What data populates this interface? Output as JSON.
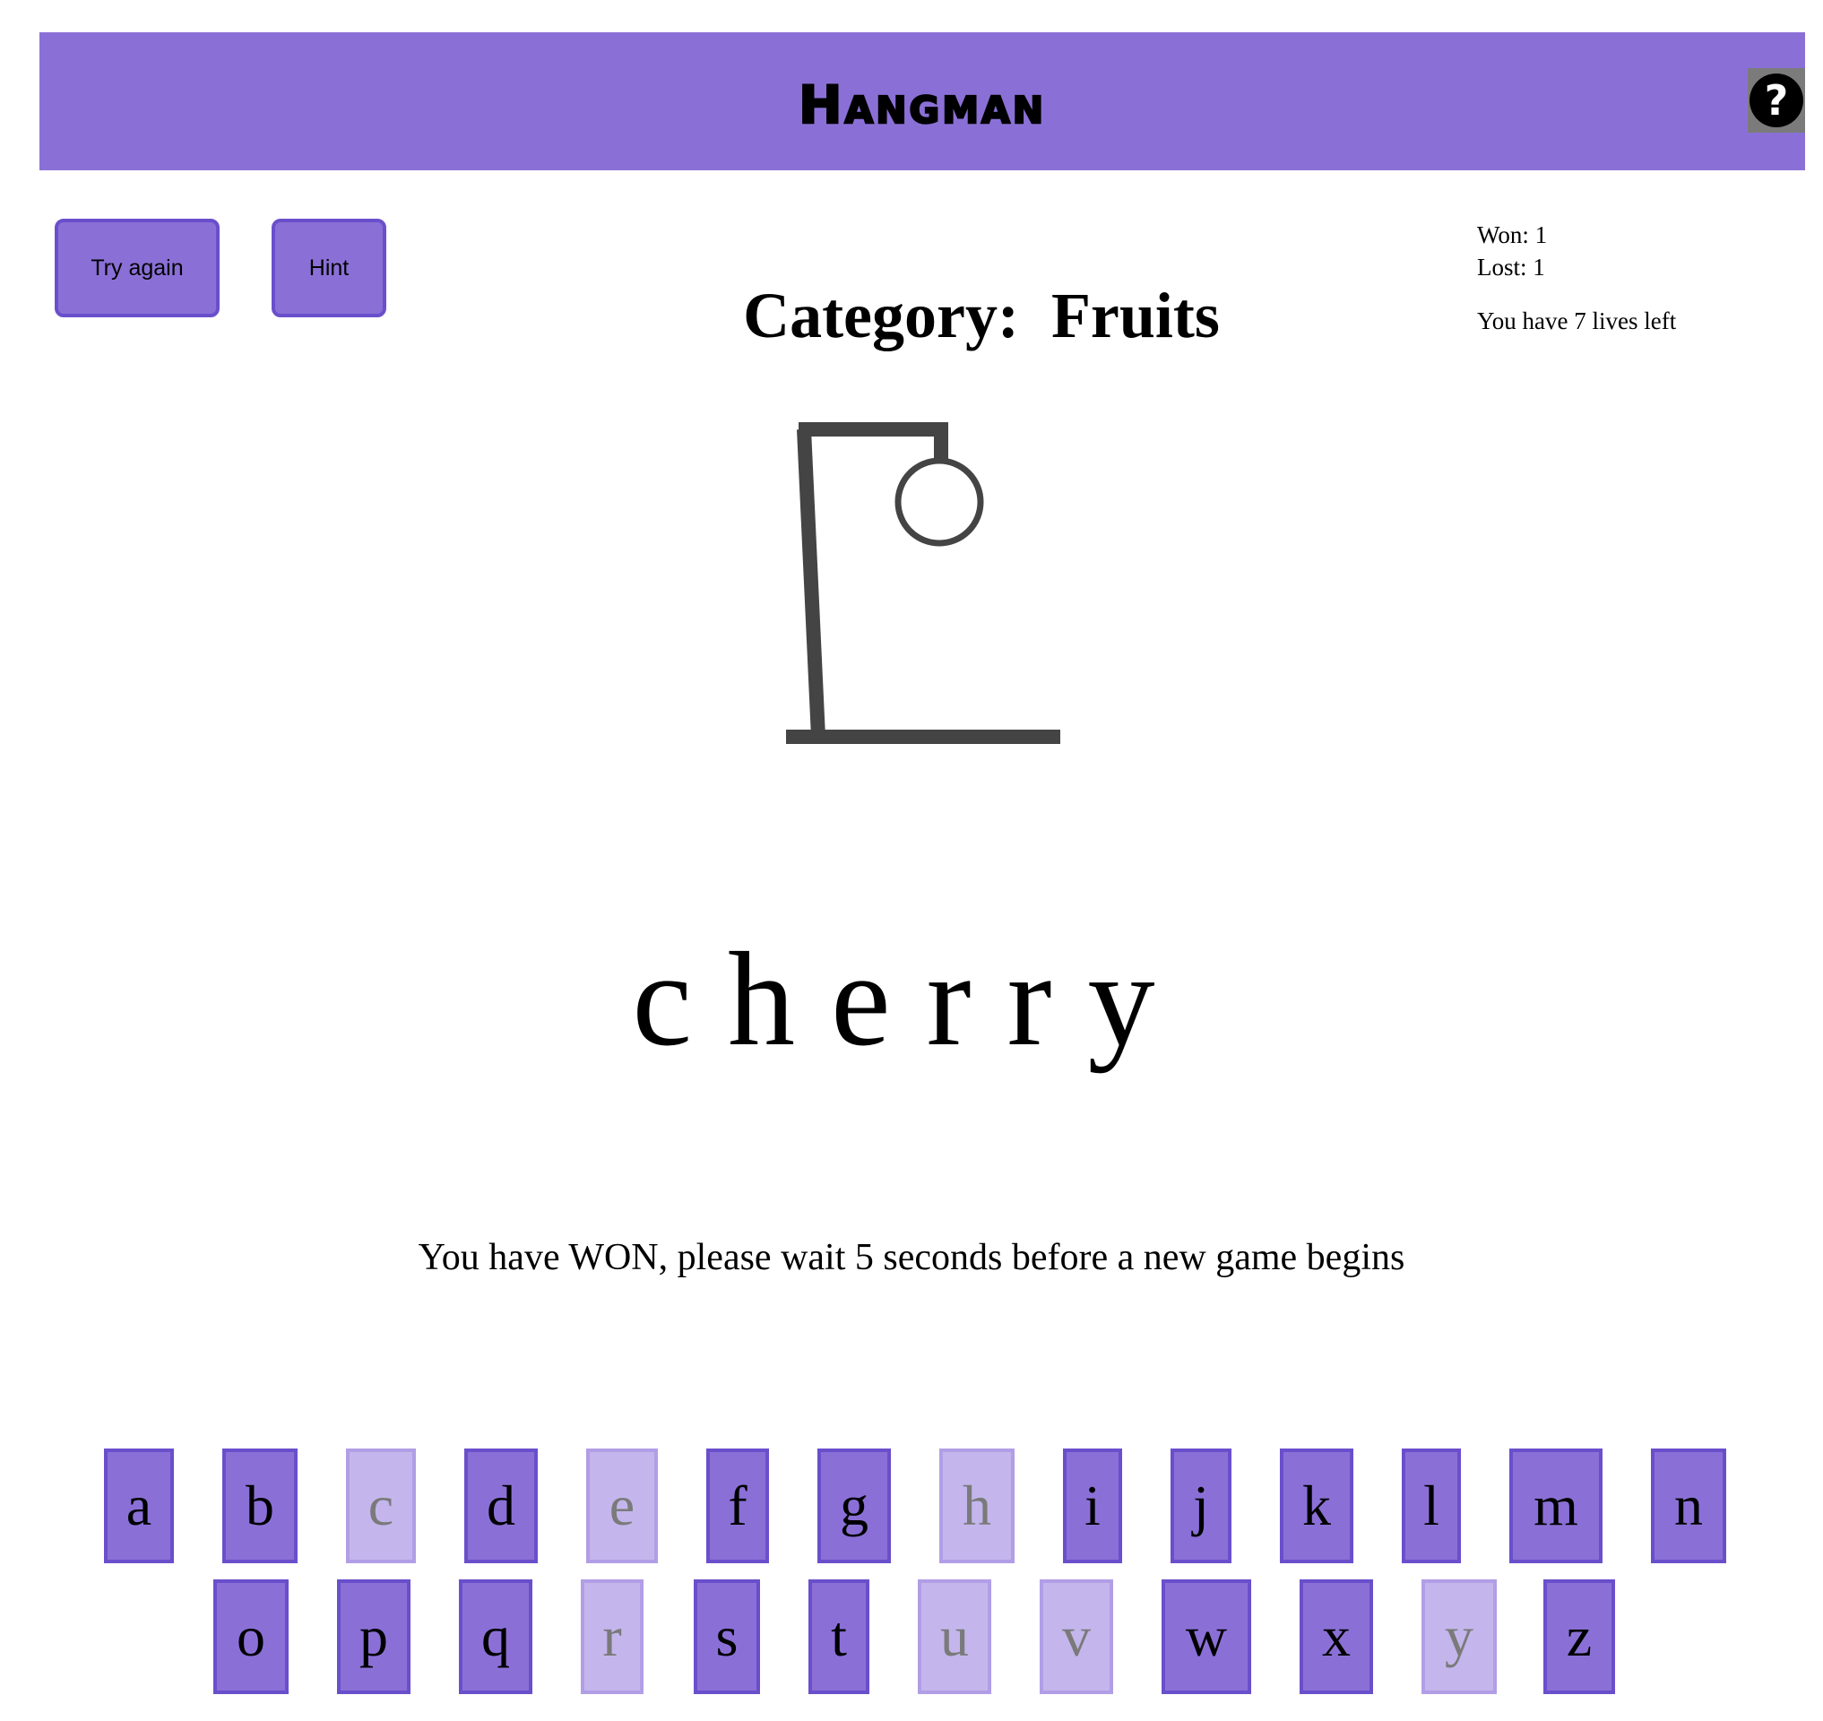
{
  "header": {
    "title": "Hangman",
    "help_label": "?"
  },
  "controls": {
    "try_again_label": "Try again",
    "hint_label": "Hint"
  },
  "stats": {
    "won_label": "Won: 1",
    "lost_label": "Lost: 1",
    "lives_label": "You have 7 lives left"
  },
  "category": {
    "text": "Category:  Fruits"
  },
  "word": {
    "letters": [
      "c",
      "h",
      "e",
      "r",
      "r",
      "y"
    ]
  },
  "message": {
    "text": "You have WON, please wait 5 seconds before a new game begins"
  },
  "keyboard": {
    "row1": [
      {
        "letter": "a",
        "used": false
      },
      {
        "letter": "b",
        "used": false
      },
      {
        "letter": "c",
        "used": true
      },
      {
        "letter": "d",
        "used": false
      },
      {
        "letter": "e",
        "used": true
      },
      {
        "letter": "f",
        "used": false
      },
      {
        "letter": "g",
        "used": false
      },
      {
        "letter": "h",
        "used": true
      },
      {
        "letter": "i",
        "used": false
      },
      {
        "letter": "j",
        "used": false
      },
      {
        "letter": "k",
        "used": false
      },
      {
        "letter": "l",
        "used": false
      },
      {
        "letter": "m",
        "used": false
      },
      {
        "letter": "n",
        "used": false
      }
    ],
    "row2": [
      {
        "letter": "o",
        "used": false
      },
      {
        "letter": "p",
        "used": false
      },
      {
        "letter": "q",
        "used": false
      },
      {
        "letter": "r",
        "used": true
      },
      {
        "letter": "s",
        "used": false
      },
      {
        "letter": "t",
        "used": false
      },
      {
        "letter": "u",
        "used": true
      },
      {
        "letter": "v",
        "used": true
      },
      {
        "letter": "w",
        "used": false
      },
      {
        "letter": "x",
        "used": false
      },
      {
        "letter": "y",
        "used": true
      },
      {
        "letter": "z",
        "used": false
      }
    ]
  },
  "colors": {
    "accent": "#8a70d6",
    "accent_border": "#6a4fcc",
    "used_key": "#c4b6ec",
    "gallows": "#444444"
  }
}
